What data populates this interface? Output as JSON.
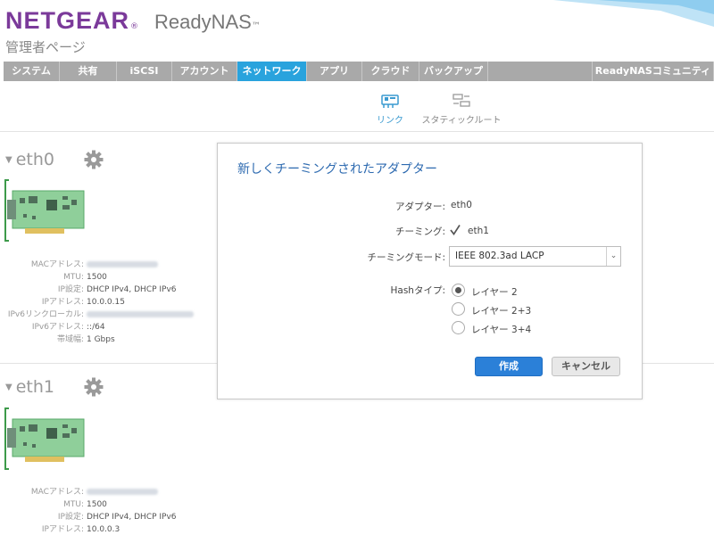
{
  "header": {
    "brand": "NETGEAR",
    "brand_mark": "®",
    "product": "ReadyNAS",
    "product_mark": "™",
    "subtitle": "管理者ページ"
  },
  "nav": {
    "tabs": [
      {
        "label": "システム"
      },
      {
        "label": "共有"
      },
      {
        "label": "iSCSI"
      },
      {
        "label": "アカウント"
      },
      {
        "label": "ネットワーク",
        "active": true
      },
      {
        "label": "アプリ"
      },
      {
        "label": "クラウド"
      },
      {
        "label": "バックアップ"
      }
    ],
    "community": "ReadyNASコミュニティ"
  },
  "subnav": {
    "link": "リンク",
    "static_route": "スタティックルート"
  },
  "adapters": [
    {
      "name": "eth0",
      "labels": {
        "mac": "MACアドレス:",
        "mtu": "MTU:",
        "ip_setting": "IP設定:",
        "ip": "IPアドレス:",
        "ipv6_link_local": "IPv6リンクローカル:",
        "ipv6": "IPv6アドレス:",
        "bandwidth": "帯域幅:"
      },
      "values": {
        "mtu": "1500",
        "ip_setting": "DHCP IPv4, DHCP IPv6",
        "ip": "10.0.0.15",
        "ipv6": "::/64",
        "bandwidth": "1 Gbps"
      }
    },
    {
      "name": "eth1",
      "labels": {
        "mac": "MACアドレス:",
        "mtu": "MTU:",
        "ip_setting": "IP設定:",
        "ip": "IPアドレス:"
      },
      "values": {
        "mtu": "1500",
        "ip_setting": "DHCP IPv4, DHCP IPv6",
        "ip": "10.0.0.3"
      }
    }
  ],
  "dialog": {
    "title": "新しくチーミングされたアダプター",
    "adapter_label": "アダプター:",
    "adapter_value": "eth0",
    "teaming_label": "チーミング:",
    "teaming_member": "eth1",
    "teaming_checked": true,
    "mode_label": "チーミングモード:",
    "mode_value": "IEEE 802.3ad LACP",
    "hash_label": "Hashタイプ:",
    "hash_options": [
      {
        "label": "レイヤー 2",
        "selected": true
      },
      {
        "label": "レイヤー 2+3",
        "selected": false
      },
      {
        "label": "レイヤー 3+4",
        "selected": false
      }
    ],
    "create_button": "作成",
    "cancel_button": "キャンセル"
  },
  "colors": {
    "brand": "#7b3a9a",
    "nav_bg": "#a9a9a9",
    "nav_active": "#29a3dd",
    "dialog_title": "#2d6ab0",
    "primary_button": "#2b80d8",
    "nic_board": "#8fcf9a"
  }
}
